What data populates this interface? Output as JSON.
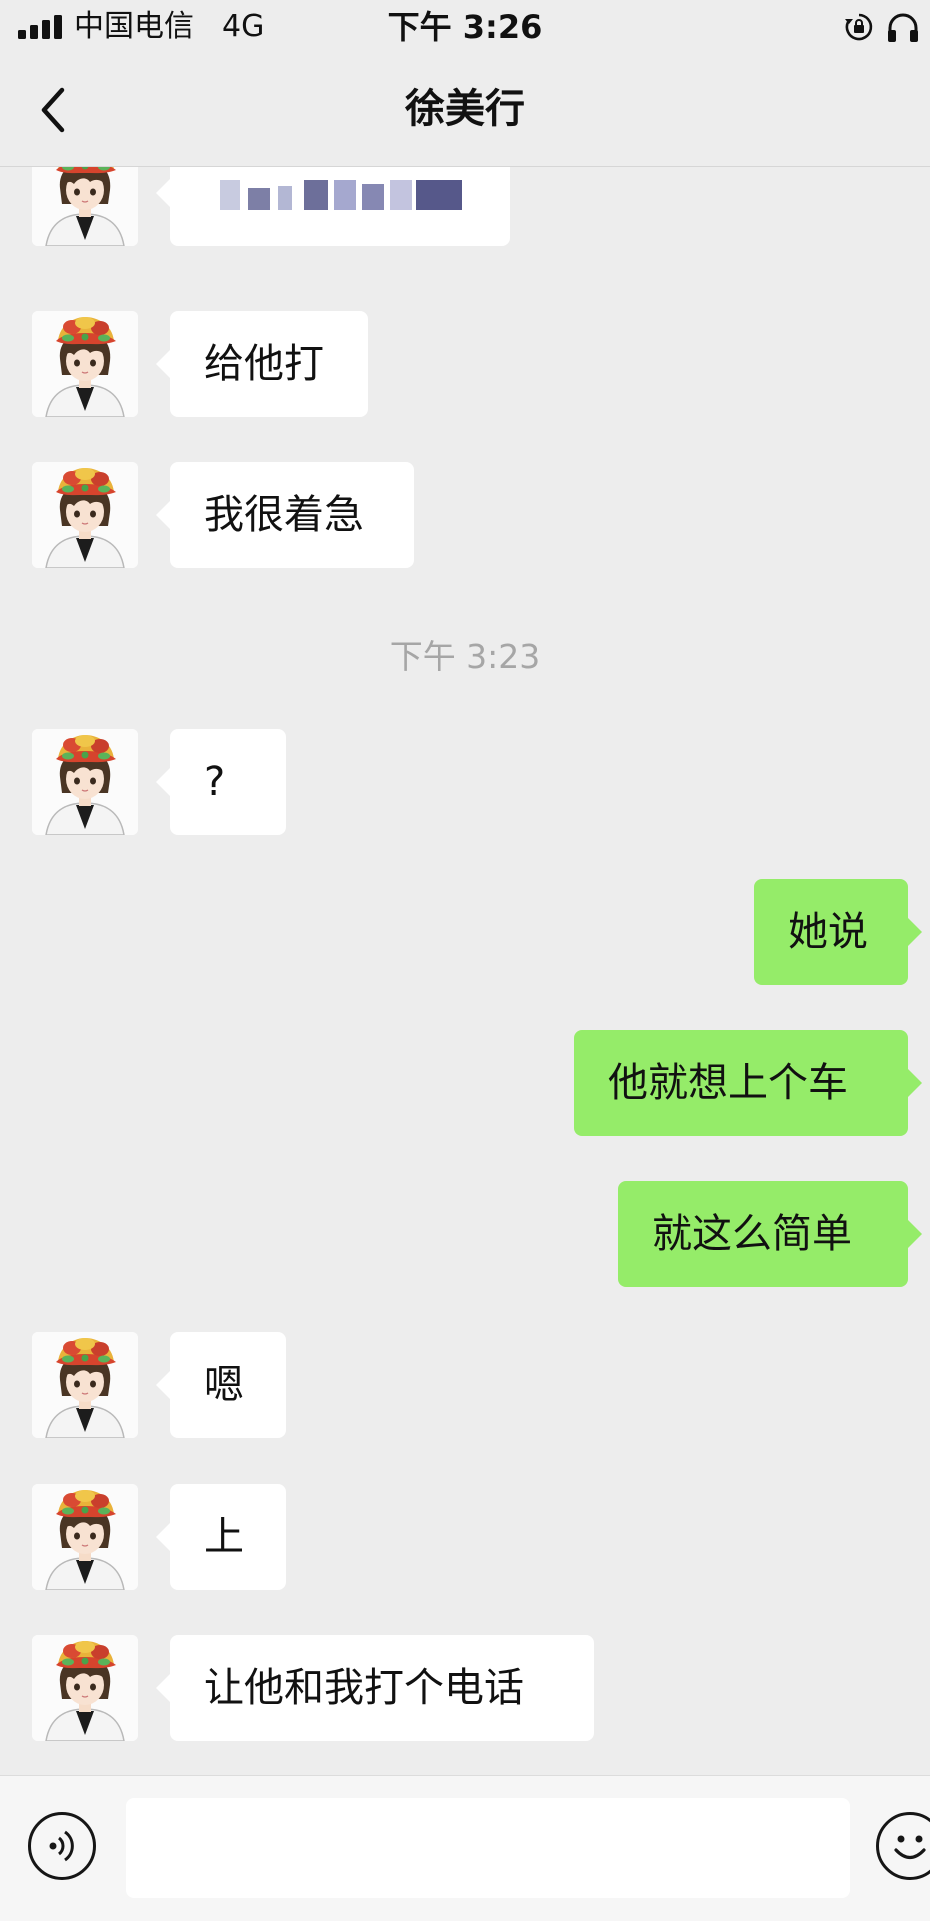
{
  "status_bar": {
    "carrier": "中国电信",
    "network": "4G",
    "time": "下午 3:26",
    "icons": [
      "signal-bars-icon",
      "rotation-lock-icon",
      "headphones-icon"
    ]
  },
  "header": {
    "title": "徐美行",
    "back_icon": "chevron-left-icon"
  },
  "messages": [
    {
      "type": "incoming",
      "text": "",
      "blurred": true
    },
    {
      "type": "incoming",
      "text": "给他打"
    },
    {
      "type": "incoming",
      "text": "我很着急"
    },
    {
      "type": "timestamp",
      "text": "下午 3:23"
    },
    {
      "type": "incoming",
      "text": "?"
    },
    {
      "type": "outgoing",
      "text": "她说"
    },
    {
      "type": "outgoing",
      "text": "他就想上个车"
    },
    {
      "type": "outgoing",
      "text": "就这么简单"
    },
    {
      "type": "incoming",
      "text": "嗯"
    },
    {
      "type": "incoming",
      "text": "上"
    },
    {
      "type": "incoming",
      "text": "让他和我打个电话"
    }
  ],
  "input_bar": {
    "voice_icon": "voice-icon",
    "text_value": "",
    "emoji_icon": "emoji-icon"
  },
  "colors": {
    "background": "#ededed",
    "incoming_bubble": "#ffffff",
    "outgoing_bubble": "#95ec69",
    "timestamp": "#a6a6a6"
  }
}
